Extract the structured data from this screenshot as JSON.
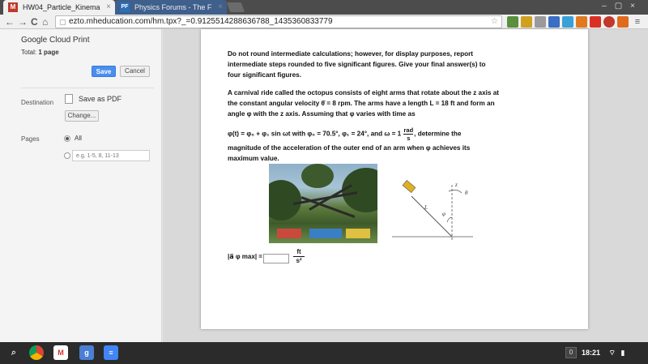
{
  "browser": {
    "tabs": [
      {
        "label": "HW04_Particle_Kinema",
        "favicon": "M"
      },
      {
        "label": "Physics Forums - The F",
        "favicon": "PF"
      }
    ],
    "url": "ezto.mheducation.com/hm.tpx?_=0.9125514288636788_1435360833779",
    "nav": {
      "back": "←",
      "forward": "→",
      "reload": "C",
      "home": "⌂"
    }
  },
  "print": {
    "title": "Google Cloud Print",
    "total_label": "Total:",
    "total_value": "1 page",
    "save_label": "Save",
    "cancel_label": "Cancel",
    "destination_label": "Destination",
    "destination_value": "Save as PDF",
    "change_label": "Change...",
    "pages_label": "Pages",
    "all_label": "All",
    "range_placeholder": "e.g. 1-5, 8, 11-13"
  },
  "problem": {
    "instructions": "Do not round intermediate calculations; however, for display purposes, report intermediate steps rounded to five significant figures. Give your final answer(s) to four significant figures.",
    "statement": "A carnival ride called the octopus consists of eight arms that rotate about the z axis at the constant angular velocity   θ̇ = 8 rpm. The arms have a length   L = 18 ft and form an angle   φ with the  z axis. Assuming that  φ varies with time as",
    "formula": "φ(t) = φ₀ + φ₁ sin ωt  with  φ₀ = 70.5°,  φ₁ = 24°, and  ω = 1",
    "formula_unit_num": "rad",
    "formula_unit_den": "s",
    "formula_tail": ", determine the",
    "statement_end": "magnitude of the acceleration of the outer end of an arm when        φ achieves its maximum value.",
    "answer_label": "|a⃗ φ max| =",
    "answer_unit_num": "ft",
    "answer_unit_den": "s²",
    "diagram_labels": {
      "z": "z",
      "theta": "θ",
      "L": "L",
      "phi": "φ"
    }
  },
  "taskbar": {
    "badge": "0",
    "time": "18:21"
  },
  "colors": {
    "tab_strip": "#4c4c4c",
    "save_button": "#4a8ef0",
    "taskbar": "#2b2b2b"
  }
}
